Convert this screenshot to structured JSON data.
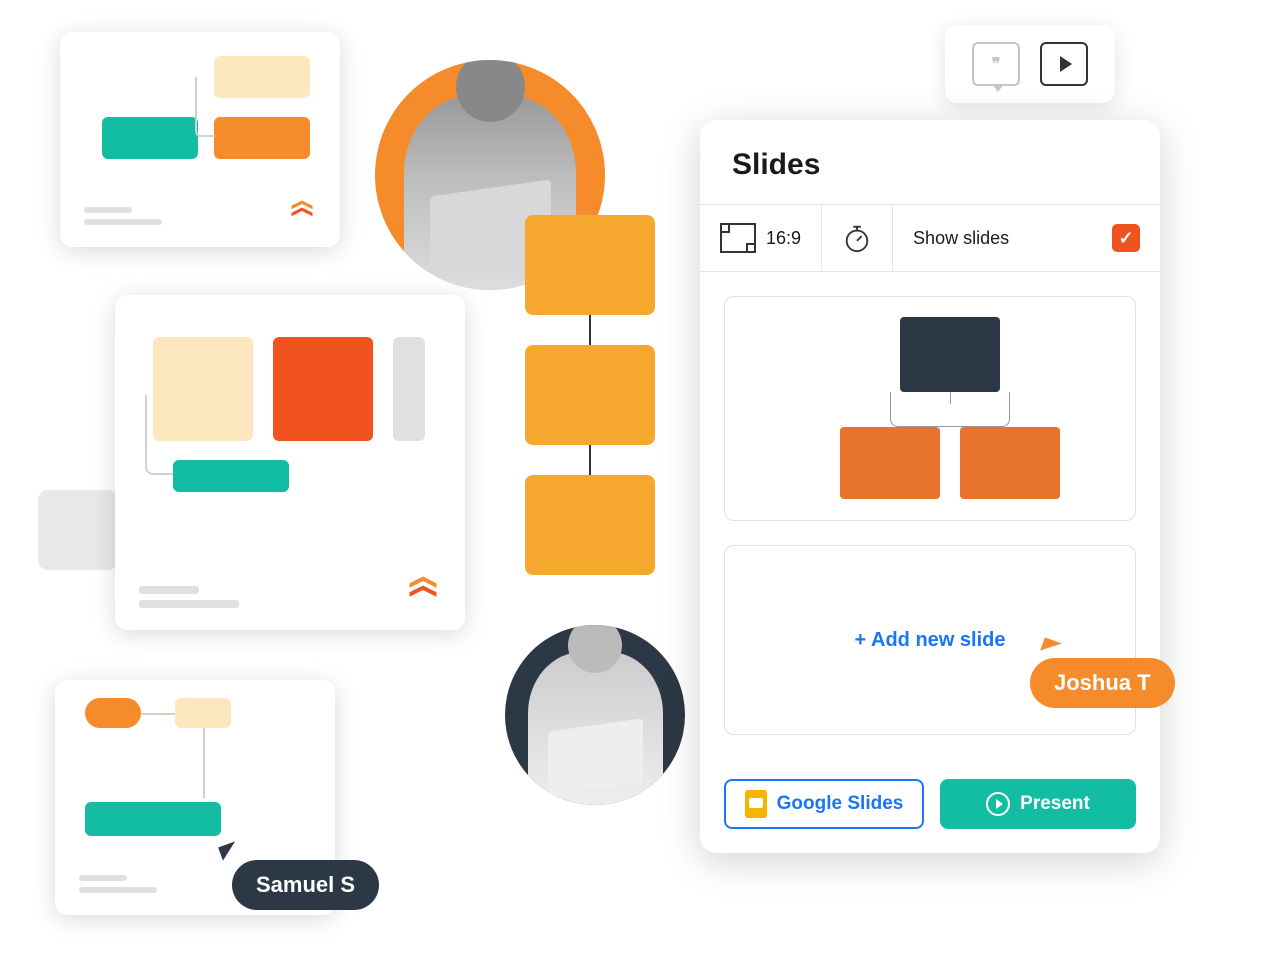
{
  "panel": {
    "title": "Slides",
    "ratio_label": "16:9",
    "show_slides_label": "Show slides",
    "show_slides_checked": true,
    "add_slide_label": "+  Add new slide",
    "google_slides_label": "Google Slides",
    "present_label": "Present"
  },
  "cursors": {
    "samuel": "Samuel S",
    "joshua": "Joshua T"
  },
  "colors": {
    "teal": "#13BDA4",
    "orange": "#F58B2B",
    "red_orange": "#F0531E",
    "amber": "#F5A82D",
    "cream": "#FDE7BF",
    "dark": "#2C3845",
    "blue": "#1976F5"
  }
}
